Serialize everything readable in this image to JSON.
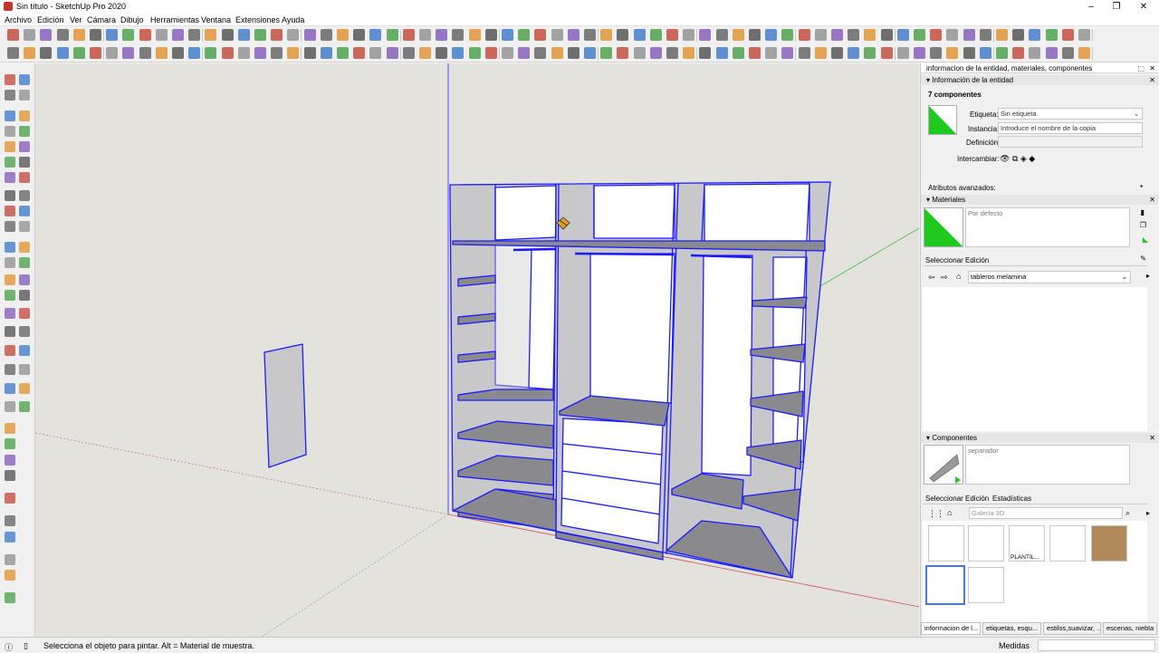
{
  "window": {
    "title": "Sin título - SketchUp Pro 2020"
  },
  "menu": [
    "Archivo",
    "Edición",
    "Ver",
    "Cámara",
    "Dibujo",
    "Herramientas",
    "Ventana",
    "Extensiones",
    "Ayuda"
  ],
  "tray": {
    "title": "informacion de la entidad, materiales, componentes",
    "entity": {
      "header": "Información de la entidad",
      "count": "7 componentes",
      "tag_label": "Etiqueta:",
      "tag_value": "Sin etiqueta",
      "instance_label": "Instancia:",
      "instance_placeholder": "Introduce el nombre de la copia",
      "definition_label": "Definición:",
      "swap_label": "Intercambiar:",
      "advanced_label": "Atributos avanzados:",
      "swatch_color": "#1fc91f"
    },
    "materials": {
      "header": "Materiales",
      "material_name": "Por defecto",
      "tab_select": "Seleccionar",
      "tab_edit": "Edición",
      "library": "tableros melamina"
    },
    "components": {
      "header": "Componentes",
      "component_name": "separador",
      "tab_select": "Seleccionar",
      "tab_edit": "Edición",
      "tab_stats": "Estadísticas",
      "search_placeholder": "Galería 3D",
      "thumb_label": "PLANTIL..."
    }
  },
  "bottom_tabs": [
    "informacion de l...",
    "etiquetas, esqu...",
    "estilos,suavizar, ...",
    "escenas, niebla"
  ],
  "status": {
    "hint": "Selecciona el objeto para pintar. Alt = Material de muestra.",
    "measure_label": "Medidas"
  },
  "colors": {
    "selection": "#1a1aff",
    "viewport_bg": "#e3e2dd",
    "shelf_gray": "#8a8a8e",
    "panel_light": "#c8c8cb"
  }
}
